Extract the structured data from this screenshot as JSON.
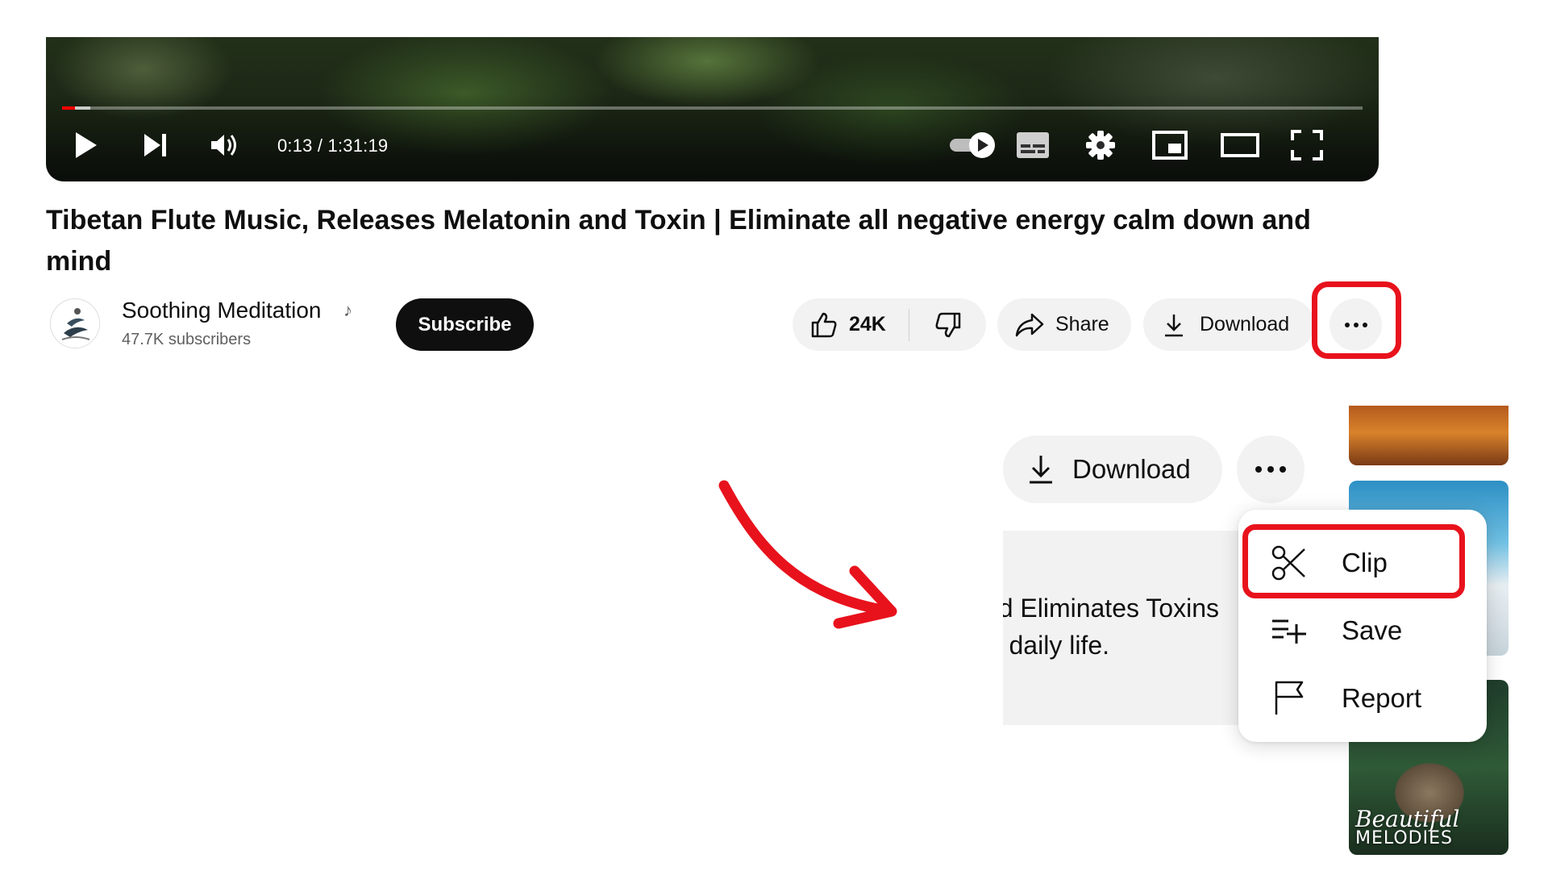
{
  "player": {
    "time_display": "0:13 / 1:31:19",
    "progress_fraction": 0.0024,
    "controls": [
      "play-icon",
      "next-icon",
      "volume-icon",
      "autoplay-toggle",
      "subtitles-icon",
      "settings-gear-icon",
      "miniplayer-icon",
      "theater-mode-icon",
      "fullscreen-icon"
    ]
  },
  "video": {
    "title": "Tibetan Flute Music, Releases Melatonin and Toxin | Eliminate all negative energy calm down and mind"
  },
  "channel": {
    "name": "Soothing Meditation",
    "badge_icon": "music-note-icon",
    "subscribers": "47.7K subscribers",
    "subscribe_label": "Subscribe"
  },
  "actions": {
    "like_count": "24K",
    "share_label": "Share",
    "download_label": "Download",
    "more_icon": "more-horizontal-icon"
  },
  "zoom_inset": {
    "download_label": "Download",
    "description_line_1": "d Eliminates Toxins",
    "description_line_2": "ır daily life.",
    "menu_items": [
      {
        "label": "Clip",
        "icon": "scissors-icon"
      },
      {
        "label": "Save",
        "icon": "playlist-add-icon"
      },
      {
        "label": "Report",
        "icon": "flag-icon"
      }
    ],
    "thumbnail_text_line_1": "Beautiful",
    "thumbnail_text_line_2": "MELODIES"
  },
  "colors": {
    "highlight": "#e8121c",
    "progress": "#ff0000",
    "pill_bg": "#f2f2f2",
    "subscribe_bg": "#0f0f0f"
  }
}
